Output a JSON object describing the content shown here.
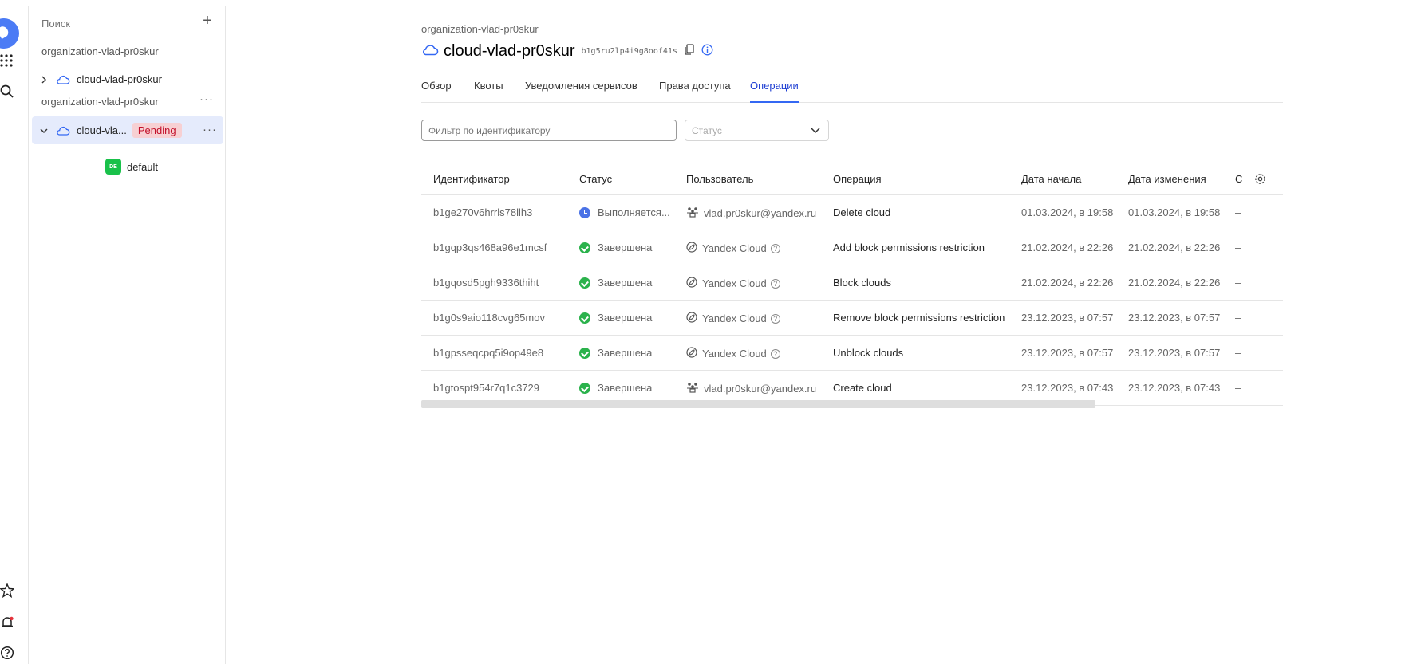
{
  "sidebar": {
    "search_placeholder": "Поиск",
    "add_symbol": "+",
    "org1_label": "organization-vlad-pr0skur",
    "org1_cloud_label": "cloud-vlad-pr0skur",
    "org2_label": "organization-vlad-pr0skur",
    "org2_cloud_label": "cloud-vla...",
    "pending_label": "Pending",
    "folder_badge": "DE",
    "folder_label": "default",
    "more_symbol": "···"
  },
  "header": {
    "breadcrumb": "organization-vlad-pr0skur",
    "title": "cloud-vlad-pr0skur",
    "cloud_id": "b1g5ru2lp4i9g8oof41s"
  },
  "tabs": [
    {
      "label": "Обзор"
    },
    {
      "label": "Квоты"
    },
    {
      "label": "Уведомления сервисов"
    },
    {
      "label": "Права доступа"
    },
    {
      "label": "Операции"
    }
  ],
  "filters": {
    "id_placeholder": "Фильтр по идентификатору",
    "status_placeholder": "Статус"
  },
  "table": {
    "columns": [
      "Идентификатор",
      "Статус",
      "Пользователь",
      "Операция",
      "Дата начала",
      "Дата изменения",
      "С"
    ],
    "rows": [
      {
        "id": "b1ge270v6hrrls78llh3",
        "status": "Выполняется...",
        "status_kind": "running",
        "user": "vlad.pr0skur@yandex.ru",
        "user_kind": "account",
        "operation": "Delete cloud",
        "start": "01.03.2024, в 19:58",
        "modified": "01.03.2024, в 19:58",
        "extra": "–"
      },
      {
        "id": "b1gqp3qs468a96e1mcsf",
        "status": "Завершена",
        "status_kind": "done",
        "user": "Yandex Cloud",
        "user_kind": "system",
        "operation": "Add block permissions restriction",
        "start": "21.02.2024, в 22:26",
        "modified": "21.02.2024, в 22:26",
        "extra": "–"
      },
      {
        "id": "b1gqosd5pgh9336thiht",
        "status": "Завершена",
        "status_kind": "done",
        "user": "Yandex Cloud",
        "user_kind": "system",
        "operation": "Block clouds",
        "start": "21.02.2024, в 22:26",
        "modified": "21.02.2024, в 22:26",
        "extra": "–"
      },
      {
        "id": "b1g0s9aio118cvg65mov",
        "status": "Завершена",
        "status_kind": "done",
        "user": "Yandex Cloud",
        "user_kind": "system",
        "operation": "Remove block permissions restriction",
        "start": "23.12.2023, в 07:57",
        "modified": "23.12.2023, в 07:57",
        "extra": "–"
      },
      {
        "id": "b1gpsseqcpq5i9op49e8",
        "status": "Завершена",
        "status_kind": "done",
        "user": "Yandex Cloud",
        "user_kind": "system",
        "operation": "Unblock clouds",
        "start": "23.12.2023, в 07:57",
        "modified": "23.12.2023, в 07:57",
        "extra": "–"
      },
      {
        "id": "b1gtospt954r7q1c3729",
        "status": "Завершена",
        "status_kind": "done",
        "user": "vlad.pr0skur@yandex.ru",
        "user_kind": "account",
        "operation": "Create cloud",
        "start": "23.12.2023, в 07:43",
        "modified": "23.12.2023, в 07:43",
        "extra": "–"
      }
    ]
  },
  "colors": {
    "accent": "#3468f3",
    "success": "#2bb24c",
    "running": "#4a72e6",
    "pending_bg": "#f7d0d3",
    "pending_text": "#c2102a",
    "selected_bg": "#e5ebfc"
  },
  "icons": [
    "cloud-icon",
    "copy-icon",
    "info-icon",
    "settings-gear-icon",
    "search-icon",
    "apps-grid-icon",
    "star-icon",
    "bell-icon",
    "help-icon"
  ]
}
